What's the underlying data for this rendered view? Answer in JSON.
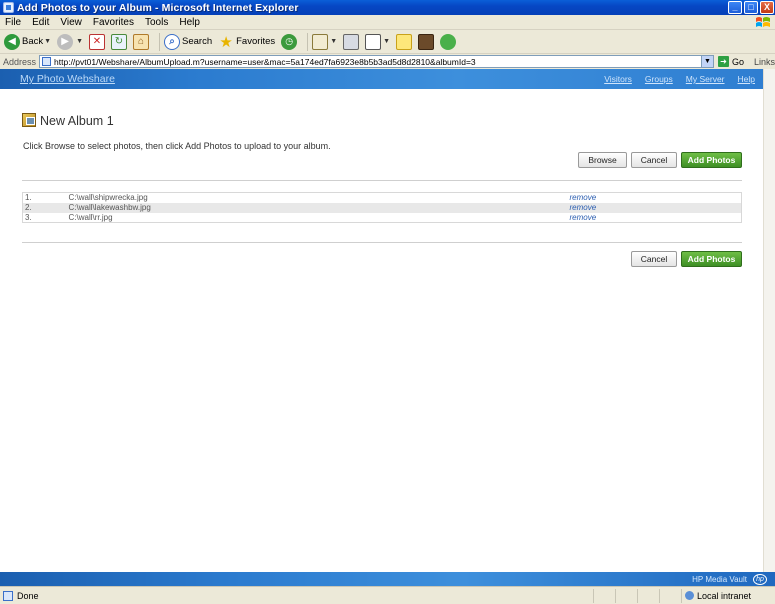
{
  "window": {
    "title": "Add Photos to your Album - Microsoft Internet Explorer",
    "minimize": "_",
    "maximize": "□",
    "close": "X"
  },
  "menu": [
    "File",
    "Edit",
    "View",
    "Favorites",
    "Tools",
    "Help"
  ],
  "toolbar": {
    "back_label": "Back",
    "search_label": "Search",
    "favorites_label": "Favorites"
  },
  "address": {
    "label": "Address",
    "url": "http://pvt01/Webshare/AlbumUpload.m?username=user&mac=5a174ed7fa6923e8b5b3ad5d8d2810&albumId=3",
    "go_label": "Go",
    "links_label": "Links"
  },
  "nav": {
    "brand": "My Photo Webshare",
    "links": [
      "Visitors",
      "Groups",
      "My Server",
      "Help"
    ]
  },
  "page": {
    "album_title": "New Album 1",
    "instruction": "Click Browse to select photos, then click Add Photos to upload to your album.",
    "browse_label": "Browse",
    "cancel_label": "Cancel",
    "add_photos_label": "Add Photos",
    "files": [
      {
        "num": "1.",
        "name": "C:\\wall\\shipwrecka.jpg",
        "action": "remove"
      },
      {
        "num": "2.",
        "name": "C:\\wall\\lakewashbw.jpg",
        "action": "remove"
      },
      {
        "num": "3.",
        "name": "C:\\wall\\rr.jpg",
        "action": "remove"
      }
    ]
  },
  "footer": {
    "product": "HP Media Vault",
    "logo_text": "hp"
  },
  "status": {
    "text": "Done",
    "zone": "Local intranet"
  },
  "colors": {
    "titlebar": "#0647c4",
    "navbar": "#2b7bcf",
    "primary_button": "#4a9d2f",
    "link": "#2a5db0"
  }
}
